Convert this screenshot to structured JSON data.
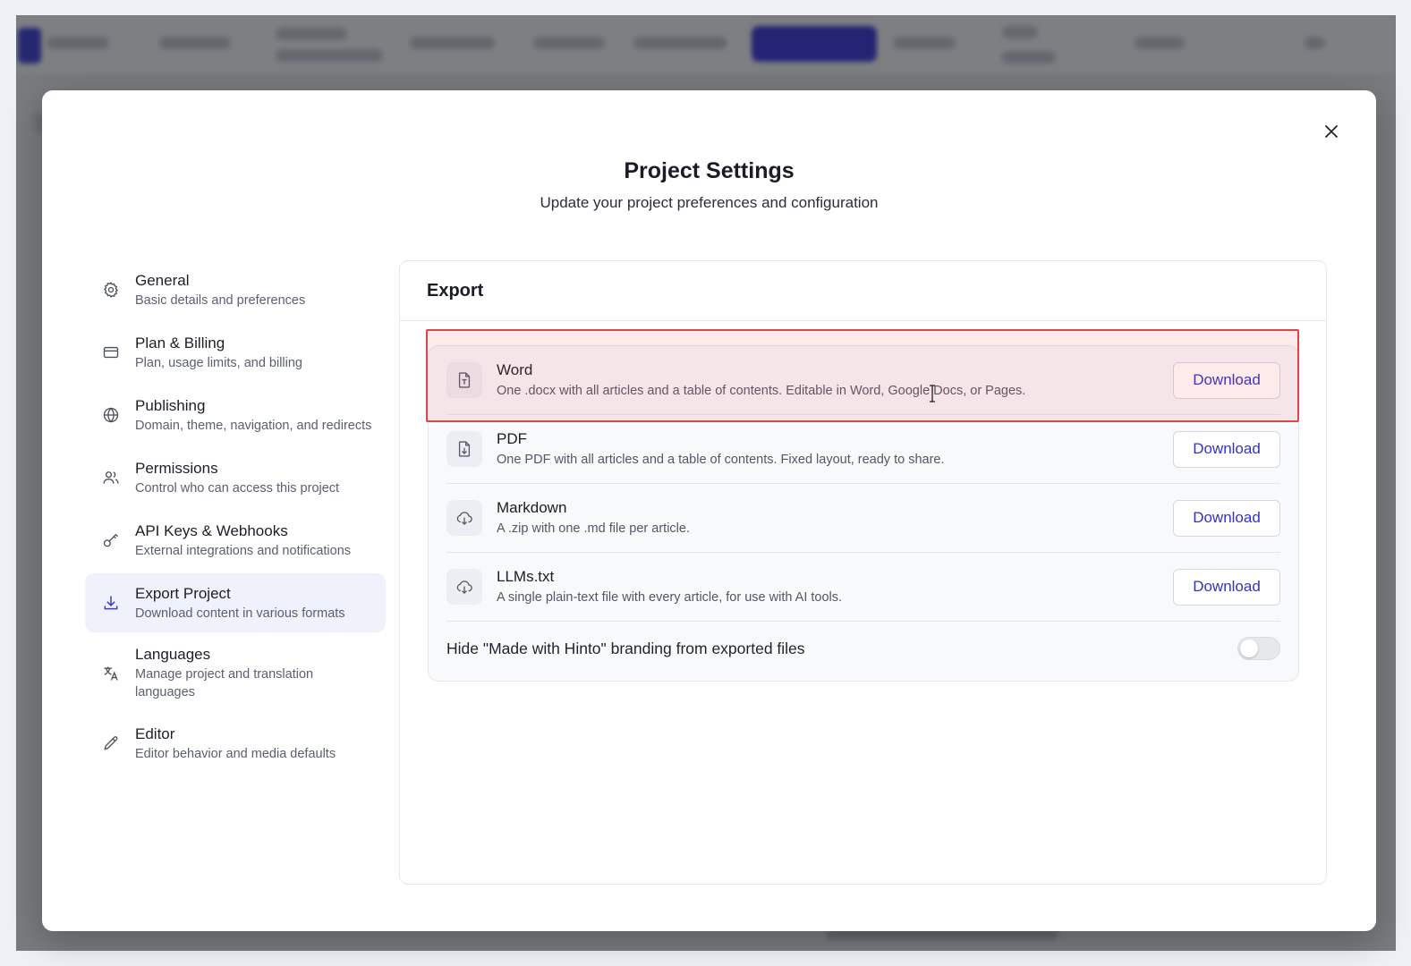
{
  "modal": {
    "title": "Project Settings",
    "subtitle": "Update your project preferences and configuration",
    "close_icon": "close-icon"
  },
  "sidebar": {
    "items": [
      {
        "label": "General",
        "desc": "Basic details and preferences",
        "icon": "gear-icon"
      },
      {
        "label": "Plan & Billing",
        "desc": "Plan, usage limits, and billing",
        "icon": "credit-card-icon"
      },
      {
        "label": "Publishing",
        "desc": "Domain, theme, navigation, and redirects",
        "icon": "globe-icon"
      },
      {
        "label": "Permissions",
        "desc": "Control who can access this project",
        "icon": "users-icon"
      },
      {
        "label": "API Keys & Webhooks",
        "desc": "External integrations and notifications",
        "icon": "key-icon"
      },
      {
        "label": "Export Project",
        "desc": "Download content in various formats",
        "icon": "download-icon",
        "active": true
      },
      {
        "label": "Languages",
        "desc": "Manage project and translation languages",
        "icon": "translate-icon"
      },
      {
        "label": "Editor",
        "desc": "Editor behavior and media defaults",
        "icon": "pen-icon"
      }
    ]
  },
  "panel": {
    "title": "Export",
    "formats": [
      {
        "title": "Word",
        "desc": "One .docx with all articles and a table of contents. Editable in Word, Google Docs, or Pages.",
        "button": "Download",
        "icon": "file-text-icon"
      },
      {
        "title": "PDF",
        "desc": "One PDF with all articles and a table of contents. Fixed layout, ready to share.",
        "button": "Download",
        "icon": "file-download-icon"
      },
      {
        "title": "Markdown",
        "desc": "A .zip with one .md file per article.",
        "button": "Download",
        "icon": "cloud-download-icon"
      },
      {
        "title": "LLMs.txt",
        "desc": "A single plain-text file with every article, for use with AI tools.",
        "button": "Download",
        "icon": "cloud-download-icon"
      }
    ],
    "branding_toggle": {
      "label": "Hide \"Made with Hinto\" branding from exported files",
      "enabled": false
    }
  },
  "colors": {
    "accent": "#3431c4",
    "highlight": "#e0454a",
    "active_nav_bg": "#eff2fb"
  }
}
